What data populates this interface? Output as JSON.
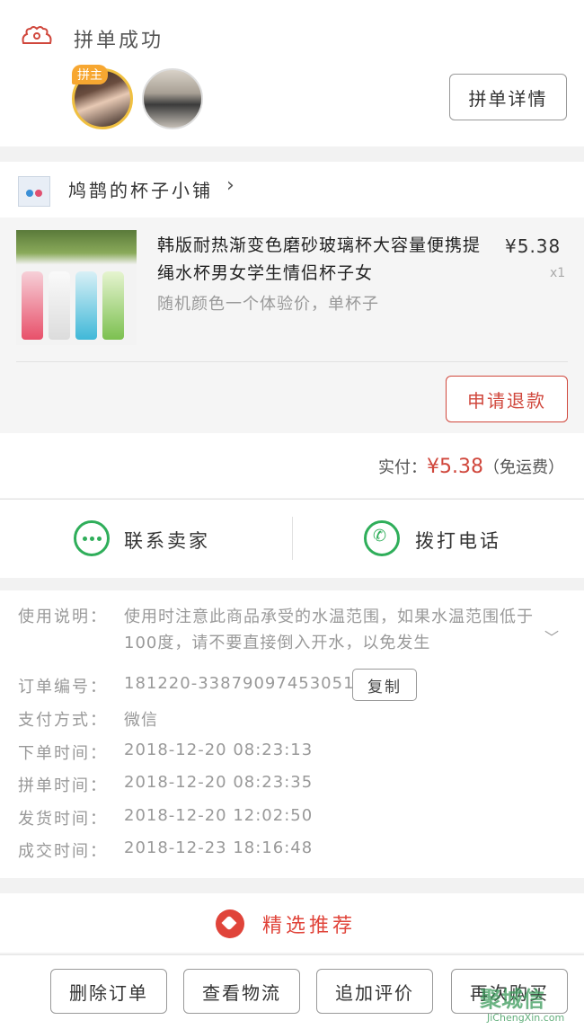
{
  "status": {
    "text": "拼单成功",
    "host_badge": "拼主",
    "detail_button": "拼单详情"
  },
  "shop": {
    "name": "鸠鹊的杯子小铺",
    "chevron": "›"
  },
  "product": {
    "title": "韩版耐热渐变色磨砂玻璃杯大容量便携提绳水杯男女学生情侣杯子女",
    "sku": "随机颜色一个体验价，单杯子",
    "price": "¥5.38",
    "qty": "x1",
    "refund_button": "申请退款"
  },
  "total": {
    "label": "实付：",
    "amount": "¥5.38",
    "note": "（免运费）"
  },
  "contact": {
    "seller": "联系卖家",
    "call": "拨打电话"
  },
  "info": {
    "usage_label": "使用说明：",
    "usage_text": "使用时注意此商品承受的水温范围，如果水温范围低于100度，请不要直接倒入开水，以免发生",
    "order_no_label": "订单编号：",
    "order_no": "181220-338790974530516",
    "copy_button": "复制",
    "pay_label": "支付方式：",
    "pay_value": "微信",
    "order_time_label": "下单时间：",
    "order_time": "2018-12-20 08:23:13",
    "group_time_label": "拼单时间：",
    "group_time": "2018-12-20 08:23:35",
    "ship_time_label": "发货时间：",
    "ship_time": "2018-12-20 12:02:50",
    "deal_time_label": "成交时间：",
    "deal_time": "2018-12-23 18:16:48"
  },
  "recommend": {
    "title": "精选推荐"
  },
  "actions": {
    "delete": "删除订单",
    "logistics": "查看物流",
    "review": "追加评价",
    "rebuy": "再次购买"
  },
  "watermark": {
    "main": "聚城信",
    "sub": "JiChengXin.com"
  },
  "colors": {
    "accent": "#d0473c",
    "green": "#2fae5a",
    "badge": "#f7a731"
  },
  "icons": [
    "group-icon",
    "shop-logo-icon",
    "chat-icon",
    "phone-icon",
    "heart-gem-icon",
    "chevron-down-icon"
  ]
}
